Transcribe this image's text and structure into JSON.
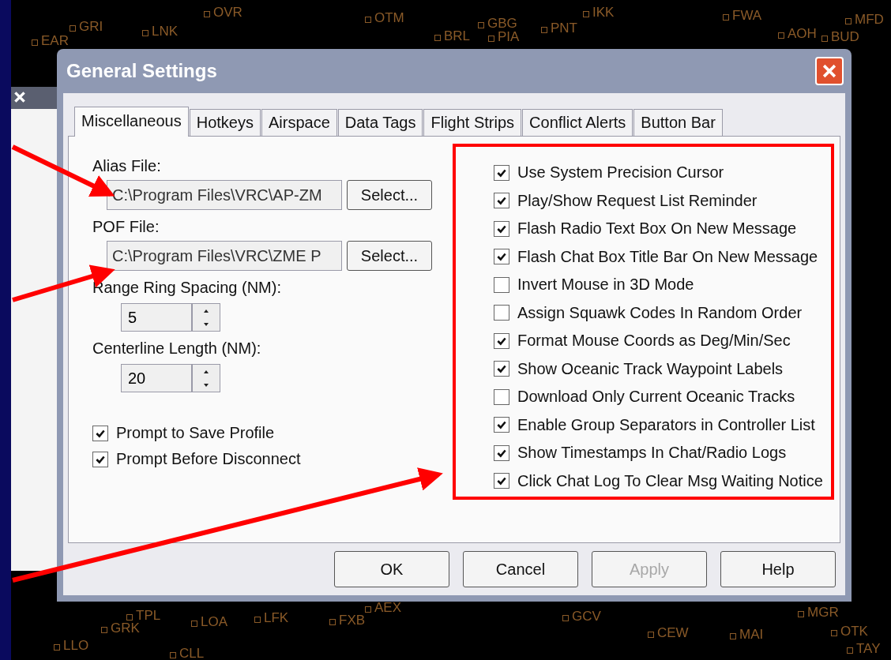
{
  "radar_labels": [
    "EAR",
    "GRI",
    "LNK",
    "OVR",
    "OTM",
    "BRL",
    "GBG",
    "PIA",
    "PNT",
    "IKK",
    "FWA",
    "AOH",
    "BUD",
    "MFD",
    "TPL",
    "GRK",
    "LOA",
    "LFK",
    "FXB",
    "AEX",
    "GCV",
    "CEW",
    "MAI",
    "MGR",
    "OTK",
    "LLO",
    "CLL",
    "TAY"
  ],
  "window": {
    "title": "General Settings"
  },
  "tabs": [
    {
      "label": "Miscellaneous",
      "selected": true
    },
    {
      "label": "Hotkeys",
      "selected": false
    },
    {
      "label": "Airspace",
      "selected": false
    },
    {
      "label": "Data Tags",
      "selected": false
    },
    {
      "label": "Flight Strips",
      "selected": false
    },
    {
      "label": "Conflict Alerts",
      "selected": false
    },
    {
      "label": "Button Bar",
      "selected": false
    }
  ],
  "file_fields": [
    {
      "label": "Alias File:",
      "value": "C:\\Program Files\\VRC\\AP-ZM",
      "button": "Select..."
    },
    {
      "label": "POF File:",
      "value": "C:\\Program Files\\VRC\\ZME P",
      "button": "Select..."
    }
  ],
  "spinners": [
    {
      "label": "Range Ring Spacing (NM):",
      "value": "5"
    },
    {
      "label": "Centerline Length (NM):",
      "value": "20"
    }
  ],
  "left_options": [
    {
      "label": "Prompt to Save Profile",
      "checked": true
    },
    {
      "label": "Prompt Before Disconnect",
      "checked": true
    }
  ],
  "right_options": [
    {
      "label": "Use System Precision Cursor",
      "checked": true
    },
    {
      "label": "Play/Show Request List Reminder",
      "checked": true
    },
    {
      "label": "Flash Radio Text Box On New Message",
      "checked": true
    },
    {
      "label": "Flash Chat Box Title Bar On New Message",
      "checked": true
    },
    {
      "label": "Invert Mouse in 3D Mode",
      "checked": false
    },
    {
      "label": "Assign Squawk Codes In Random Order",
      "checked": false
    },
    {
      "label": "Format Mouse Coords as Deg/Min/Sec",
      "checked": true
    },
    {
      "label": "Show Oceanic Track Waypoint Labels",
      "checked": true
    },
    {
      "label": "Download Only Current Oceanic Tracks",
      "checked": false
    },
    {
      "label": "Enable Group Separators in Controller List",
      "checked": true
    },
    {
      "label": "Show Timestamps In Chat/Radio Logs",
      "checked": true
    },
    {
      "label": "Click Chat Log To Clear Msg Waiting Notice",
      "checked": true
    }
  ],
  "buttons": [
    {
      "label": "OK",
      "disabled": false
    },
    {
      "label": "Cancel",
      "disabled": false
    },
    {
      "label": "Apply",
      "disabled": true
    },
    {
      "label": "Help",
      "disabled": false
    }
  ]
}
